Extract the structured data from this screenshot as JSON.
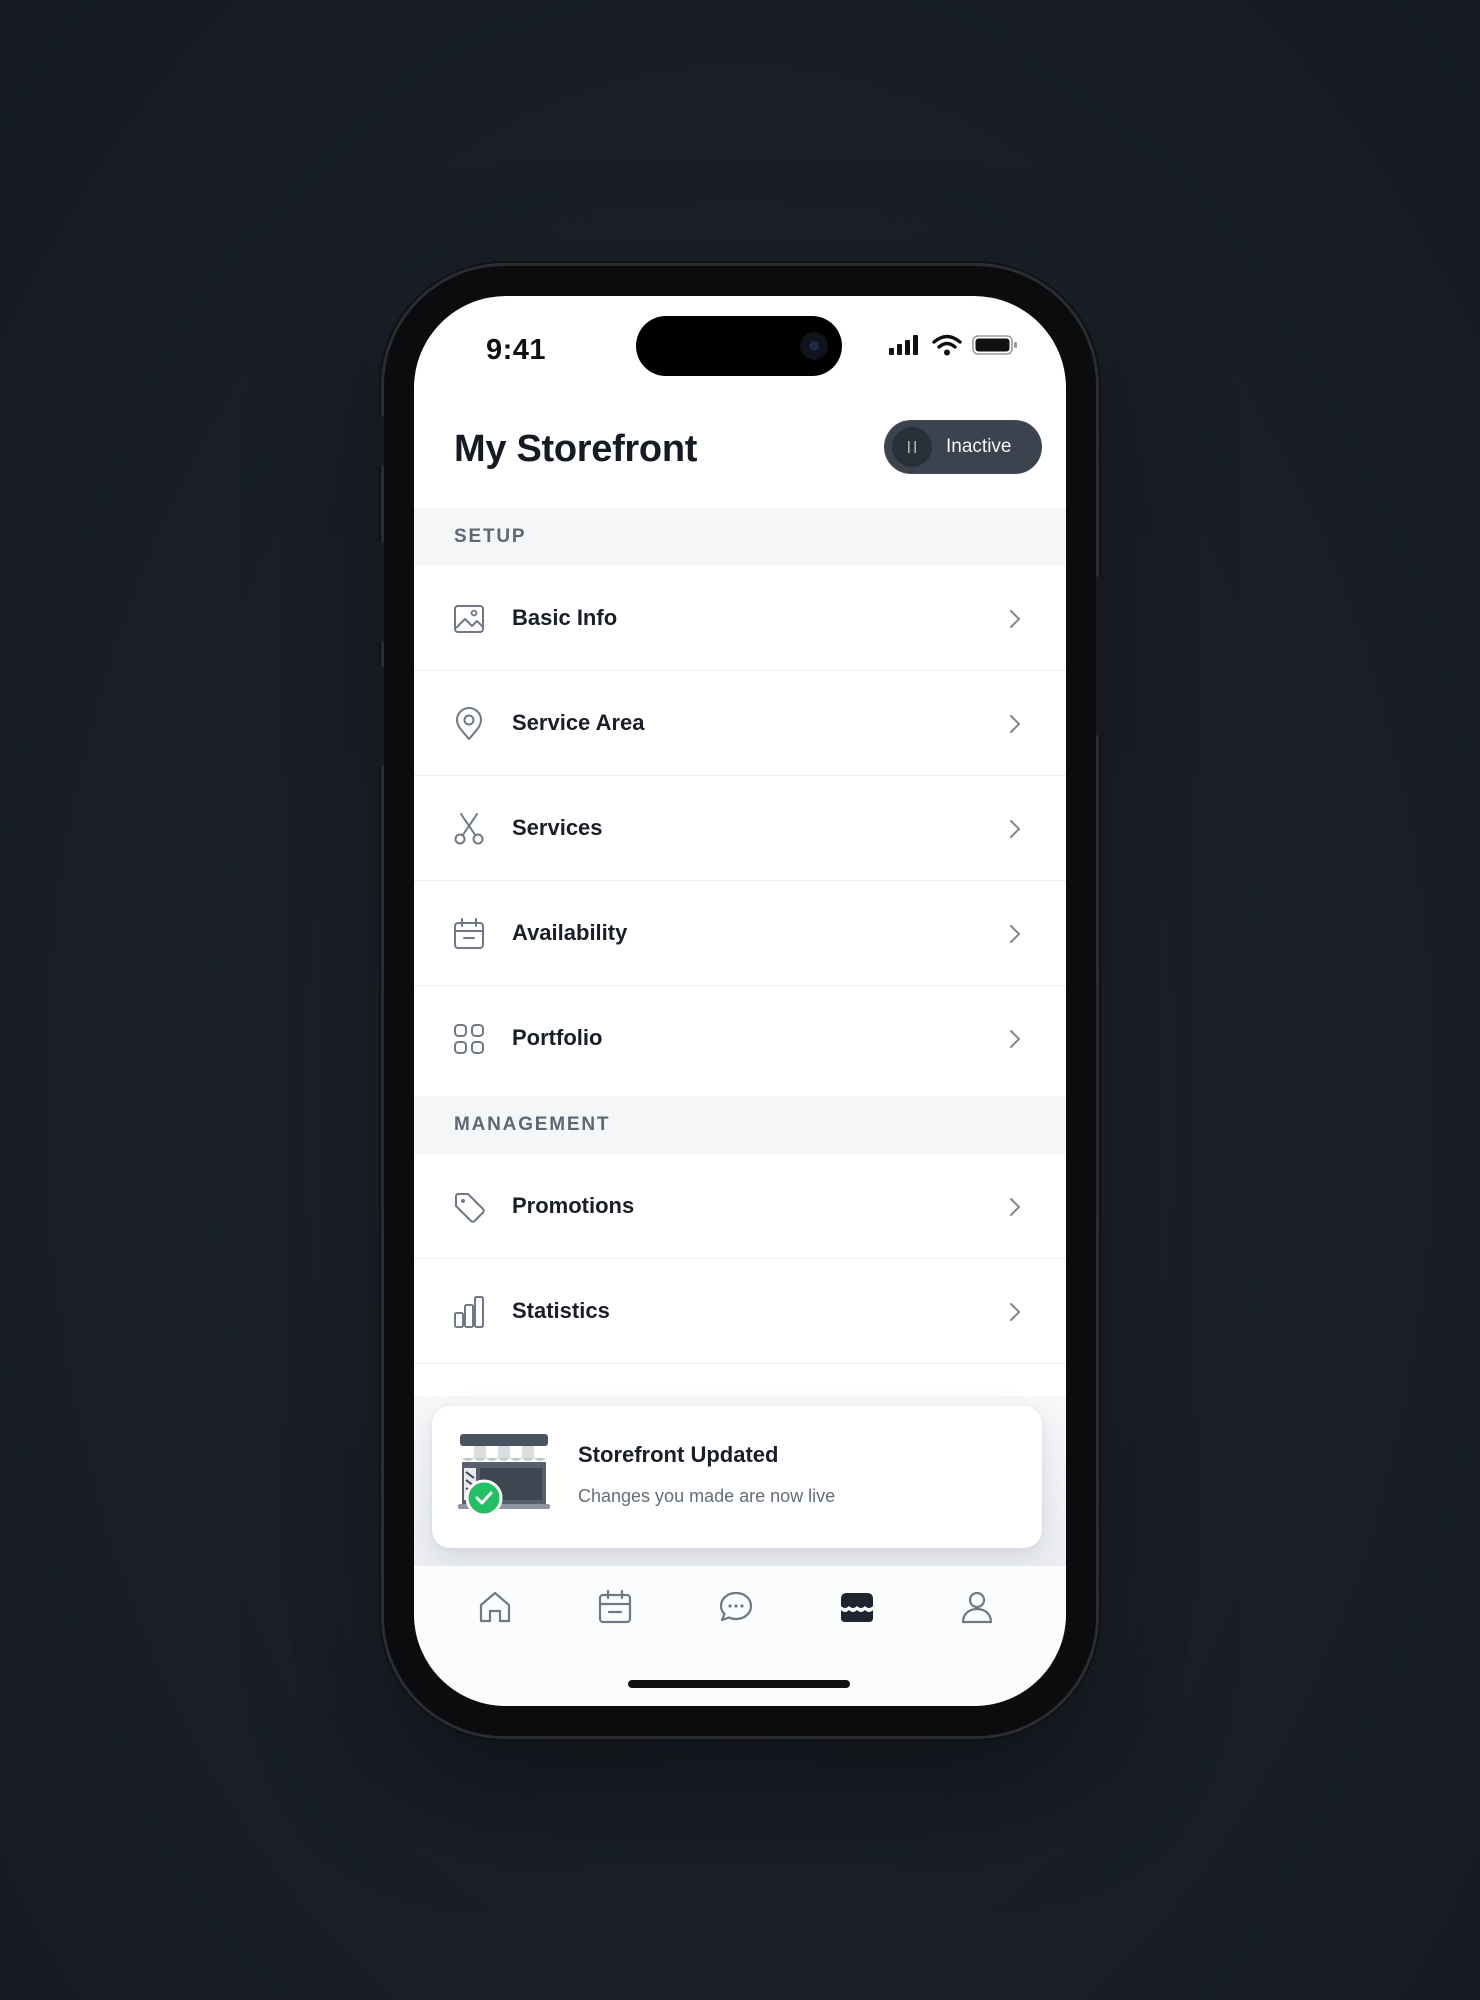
{
  "status_bar": {
    "time": "9:41"
  },
  "header": {
    "title": "My Storefront",
    "status_toggle": {
      "label": "Inactive",
      "state": "paused"
    }
  },
  "sections": [
    {
      "heading": "SETUP",
      "items": [
        {
          "label": "Basic Info",
          "icon": "image-icon"
        },
        {
          "label": "Service Area",
          "icon": "location-pin-icon"
        },
        {
          "label": "Services",
          "icon": "scissors-icon"
        },
        {
          "label": "Availability",
          "icon": "calendar-icon"
        },
        {
          "label": "Portfolio",
          "icon": "grid-icon"
        }
      ]
    },
    {
      "heading": "MANAGEMENT",
      "items": [
        {
          "label": "Promotions",
          "icon": "tag-icon"
        },
        {
          "label": "Statistics",
          "icon": "bar-chart-icon"
        }
      ]
    }
  ],
  "toast": {
    "title": "Storefront Updated",
    "message": "Changes you made are now live",
    "icon": "storefront-check-illustration"
  },
  "tab_bar": {
    "tabs": [
      {
        "icon": "home-icon",
        "active": false
      },
      {
        "icon": "calendar-icon",
        "active": false
      },
      {
        "icon": "chat-bubble-icon",
        "active": false
      },
      {
        "icon": "storefront-icon",
        "active": true
      },
      {
        "icon": "profile-icon",
        "active": false
      }
    ]
  },
  "colors": {
    "accent_dark": "#1e2530",
    "success": "#22c063",
    "section_bg": "#f4f6f8",
    "pill_bg": "#3c434e"
  }
}
